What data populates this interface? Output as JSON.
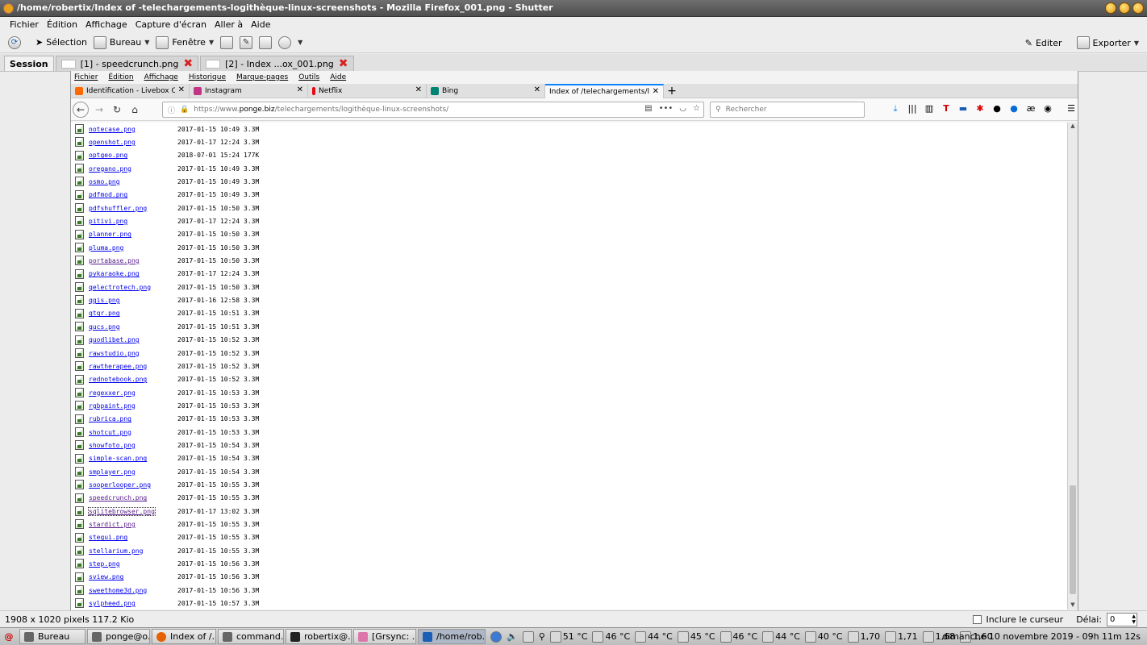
{
  "window": {
    "title": "/home/robertix/Index of -telechargements-logithèque-linux-screenshots - Mozilla Firefox_001.png - Shutter"
  },
  "menubar": [
    "Fichier",
    "Édition",
    "Affichage",
    "Capture d'écran",
    "Aller à",
    "Aide"
  ],
  "toolbar": {
    "selection": "Sélection",
    "bureau": "Bureau",
    "fenetre": "Fenêtre",
    "editer": "Editer",
    "exporter": "Exporter"
  },
  "session_tabs": {
    "session": "Session",
    "tab1": "[1] - speedcrunch.png",
    "tab2": "[2] - Index ...ox_001.png"
  },
  "firefox": {
    "menu": [
      "Fichier",
      "Édition",
      "Affichage",
      "Historique",
      "Marque-pages",
      "Outils",
      "Aide"
    ],
    "tabs": [
      {
        "label": "Identification - Livebox C",
        "color": "#ff6a00"
      },
      {
        "label": "Instagram",
        "color": "#c13584"
      },
      {
        "label": "Netflix",
        "color": "#e50914"
      },
      {
        "label": "Bing",
        "color": "#008373"
      },
      {
        "label": "Index of /telechargements/lo",
        "color": "#ffffff"
      }
    ],
    "url_prefix": "https://www.",
    "url_host": "ponge.biz",
    "url_path": "/telechargements/logithèque-linux-screenshots/",
    "search_placeholder": "Rechercher"
  },
  "files": [
    {
      "name": "notecase.png",
      "date": "2017-01-15 10:49",
      "size": "3.3M"
    },
    {
      "name": "openshot.png",
      "date": "2017-01-17 12:24",
      "size": "3.3M"
    },
    {
      "name": "optgeo.png",
      "date": "2018-07-01 15:24",
      "size": "177K"
    },
    {
      "name": "oregano.png",
      "date": "2017-01-15 10:49",
      "size": "3.3M"
    },
    {
      "name": "osmo.png",
      "date": "2017-01-15 10:49",
      "size": "3.3M"
    },
    {
      "name": "pdfmod.png",
      "date": "2017-01-15 10:49",
      "size": "3.3M"
    },
    {
      "name": "pdfshuffler.png",
      "date": "2017-01-15 10:50",
      "size": "3.3M"
    },
    {
      "name": "pitivi.png",
      "date": "2017-01-17 12:24",
      "size": "3.3M"
    },
    {
      "name": "planner.png",
      "date": "2017-01-15 10:50",
      "size": "3.3M"
    },
    {
      "name": "pluma.png",
      "date": "2017-01-15 10:50",
      "size": "3.3M"
    },
    {
      "name": "portabase.png",
      "date": "2017-01-15 10:50",
      "size": "3.3M",
      "visited": true
    },
    {
      "name": "pykaraoke.png",
      "date": "2017-01-17 12:24",
      "size": "3.3M"
    },
    {
      "name": "qelectrotech.png",
      "date": "2017-01-15 10:50",
      "size": "3.3M"
    },
    {
      "name": "qgis.png",
      "date": "2017-01-16 12:58",
      "size": "3.3M"
    },
    {
      "name": "qtqr.png",
      "date": "2017-01-15 10:51",
      "size": "3.3M"
    },
    {
      "name": "qucs.png",
      "date": "2017-01-15 10:51",
      "size": "3.3M"
    },
    {
      "name": "quodlibet.png",
      "date": "2017-01-15 10:52",
      "size": "3.3M"
    },
    {
      "name": "rawstudio.png",
      "date": "2017-01-15 10:52",
      "size": "3.3M"
    },
    {
      "name": "rawtherapee.png",
      "date": "2017-01-15 10:52",
      "size": "3.3M"
    },
    {
      "name": "rednotebook.png",
      "date": "2017-01-15 10:52",
      "size": "3.3M"
    },
    {
      "name": "regexxer.png",
      "date": "2017-01-15 10:53",
      "size": "3.3M"
    },
    {
      "name": "rgbpaint.png",
      "date": "2017-01-15 10:53",
      "size": "3.3M"
    },
    {
      "name": "rubrica.png",
      "date": "2017-01-15 10:53",
      "size": "3.3M"
    },
    {
      "name": "shotcut.png",
      "date": "2017-01-15 10:53",
      "size": "3.3M"
    },
    {
      "name": "showfoto.png",
      "date": "2017-01-15 10:54",
      "size": "3.3M"
    },
    {
      "name": "simple-scan.png",
      "date": "2017-01-15 10:54",
      "size": "3.3M"
    },
    {
      "name": "smplayer.png",
      "date": "2017-01-15 10:54",
      "size": "3.3M"
    },
    {
      "name": "sooperlooper.png",
      "date": "2017-01-15 10:55",
      "size": "3.3M"
    },
    {
      "name": "speedcrunch.png",
      "date": "2017-01-15 10:55",
      "size": "3.3M",
      "visited": true
    },
    {
      "name": "sqlitebrowser.png",
      "date": "2017-01-17 13:02",
      "size": "3.3M",
      "visited": true,
      "focused": true
    },
    {
      "name": "stardict.png",
      "date": "2017-01-15 10:55",
      "size": "3.3M",
      "visited": true
    },
    {
      "name": "stegui.png",
      "date": "2017-01-15 10:55",
      "size": "3.3M"
    },
    {
      "name": "stellarium.png",
      "date": "2017-01-15 10:55",
      "size": "3.3M"
    },
    {
      "name": "step.png",
      "date": "2017-01-15 10:56",
      "size": "3.3M"
    },
    {
      "name": "sview.png",
      "date": "2017-01-15 10:56",
      "size": "3.3M"
    },
    {
      "name": "sweethome3d.png",
      "date": "2017-01-15 10:56",
      "size": "3.3M"
    },
    {
      "name": "sylpheed.png",
      "date": "2017-01-15 10:57",
      "size": "3.3M"
    }
  ],
  "status": {
    "info": "1908 x 1020 pixels  117.2 Kio",
    "cursor_label": "Inclure le curseur",
    "delay_label": "Délai:",
    "delay_value": "0"
  },
  "taskbar": {
    "items": [
      "Bureau",
      "ponge@o...",
      "Index of /...",
      "command...",
      "robertix@...",
      "[Grsync: ...",
      "/home/rob..."
    ],
    "temps": [
      "51 °C",
      "46 °C",
      "44 °C",
      "45 °C",
      "46 °C",
      "44 °C",
      "40 °C"
    ],
    "loads": [
      "1,70",
      "1,71",
      "1,68",
      "1,60"
    ],
    "clock": "dimanche 10 novembre 2019 - 09h 11m 12s"
  }
}
